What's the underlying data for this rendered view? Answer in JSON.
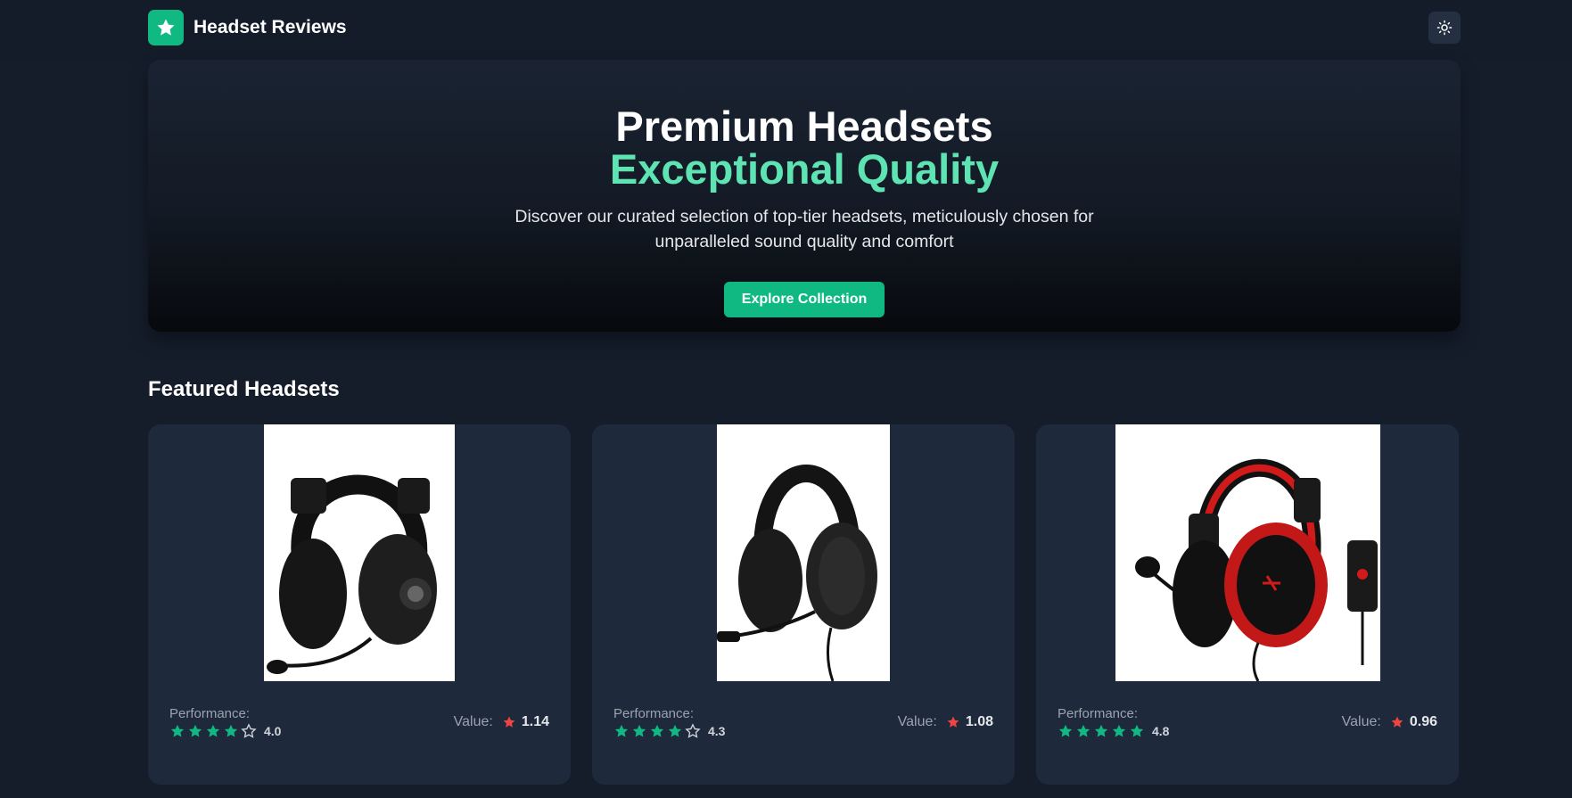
{
  "brand": {
    "name": "Headset Reviews",
    "logo_icon": "star-icon",
    "accent": "#10b981"
  },
  "header": {
    "theme_toggle_icon": "sun-icon"
  },
  "hero": {
    "title": "Premium Headsets",
    "accent_title": "Exceptional Quality",
    "description": "Discover our curated selection of top-tier headsets, meticulously chosen for unparalleled sound quality and comfort",
    "cta_label": "Explore Collection"
  },
  "featured": {
    "title": "Featured Headsets",
    "products": [
      {
        "performance_label": "Performance:",
        "performance": "4.0",
        "stars_filled": 4,
        "value_label": "Value:",
        "value": "1.14",
        "colors": [
          "#111111",
          "#222222"
        ]
      },
      {
        "performance_label": "Performance:",
        "performance": "4.3",
        "stars_filled": 4,
        "value_label": "Value:",
        "value": "1.08",
        "colors": [
          "#141414",
          "#1c1c1c"
        ]
      },
      {
        "performance_label": "Performance:",
        "performance": "4.8",
        "stars_filled": 5,
        "value_label": "Value:",
        "value": "0.96",
        "colors": [
          "#111111",
          "#d11a1a"
        ]
      }
    ]
  },
  "colors": {
    "star_filled": "#10b981",
    "value_star": "#ef4444",
    "background": "#151d2b",
    "card": "#1e293b"
  }
}
